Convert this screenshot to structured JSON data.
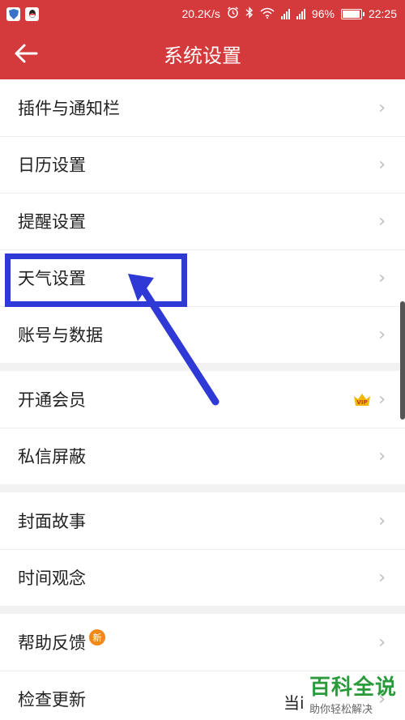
{
  "status_bar": {
    "speed": "20.2K/s",
    "battery": "96%",
    "battery_level": 0.96,
    "time": "22:25",
    "icons": [
      "shield-app-icon",
      "qq-app-icon",
      "alarm-icon",
      "bluetooth-icon",
      "wifi-icon",
      "signal-icon",
      "signal-icon",
      "battery-icon"
    ]
  },
  "header": {
    "title": "系统设置",
    "back_icon": "back-arrow-icon"
  },
  "groups": [
    {
      "items": [
        {
          "label": "插件与通知栏"
        },
        {
          "label": "日历设置"
        },
        {
          "label": "提醒设置"
        },
        {
          "label": "天气设置"
        },
        {
          "label": "账号与数据"
        }
      ]
    },
    {
      "items": [
        {
          "label": "开通会员",
          "badge": "VIP"
        },
        {
          "label": "私信屏蔽"
        }
      ]
    },
    {
      "items": [
        {
          "label": "封面故事"
        },
        {
          "label": "时间观念"
        }
      ]
    },
    {
      "items": [
        {
          "label": "帮助反馈",
          "badge": "新"
        },
        {
          "label": "检查更新"
        }
      ]
    }
  ],
  "chevron": "›",
  "overlay": {
    "cut_text": "当i",
    "watermark_title": "百科全说",
    "watermark_sub": "助你轻松解决",
    "annotation_color": "#2f39d6"
  },
  "colors": {
    "primary": "#d4393c",
    "background": "#f2f2f2",
    "vip": "#f2b705",
    "new_badge": "#f0891a"
  }
}
